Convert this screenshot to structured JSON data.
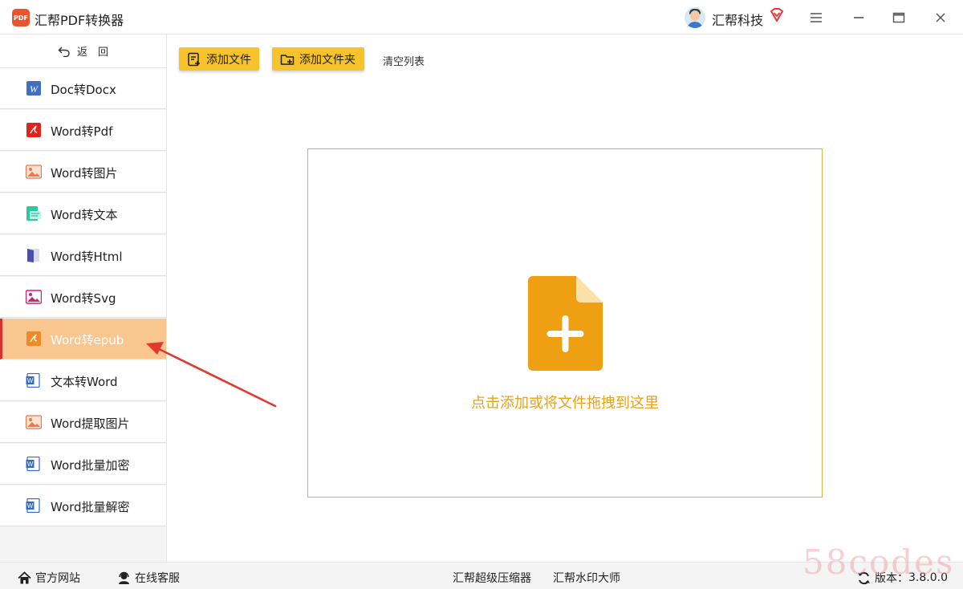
{
  "window": {
    "title": "汇帮PDF转换器",
    "logo_text": "PDF",
    "user_name": "汇帮科技"
  },
  "sidebar": {
    "back_label": "返　回",
    "items": [
      {
        "label": "Doc转Docx"
      },
      {
        "label": "Word转Pdf"
      },
      {
        "label": "Word转图片"
      },
      {
        "label": "Word转文本"
      },
      {
        "label": "Word转Html"
      },
      {
        "label": "Word转Svg"
      },
      {
        "label": "Word转epub",
        "active": true
      },
      {
        "label": "文本转Word"
      },
      {
        "label": "Word提取图片"
      },
      {
        "label": "Word批量加密"
      },
      {
        "label": "Word批量解密"
      }
    ]
  },
  "toolbar": {
    "add_file": "添加文件",
    "add_folder": "添加文件夹",
    "clear_list": "清空列表"
  },
  "dropzone": {
    "hint": "点击添加或将文件拖拽到这里"
  },
  "footer": {
    "official_site": "官方网站",
    "online_service": "在线客服",
    "compressor": "汇帮超级压缩器",
    "watermark_master": "汇帮水印大师",
    "version_label": "版本：",
    "version": "3.8.0.0"
  },
  "overlay": {
    "watermark_text": "58codes"
  },
  "colors": {
    "accent_yellow": "#f7c32c",
    "drop_text": "#e8a21a",
    "active_item_bg": "#f9c690",
    "active_border": "#d9302a",
    "annotation_arrow": "#e03a2e"
  }
}
